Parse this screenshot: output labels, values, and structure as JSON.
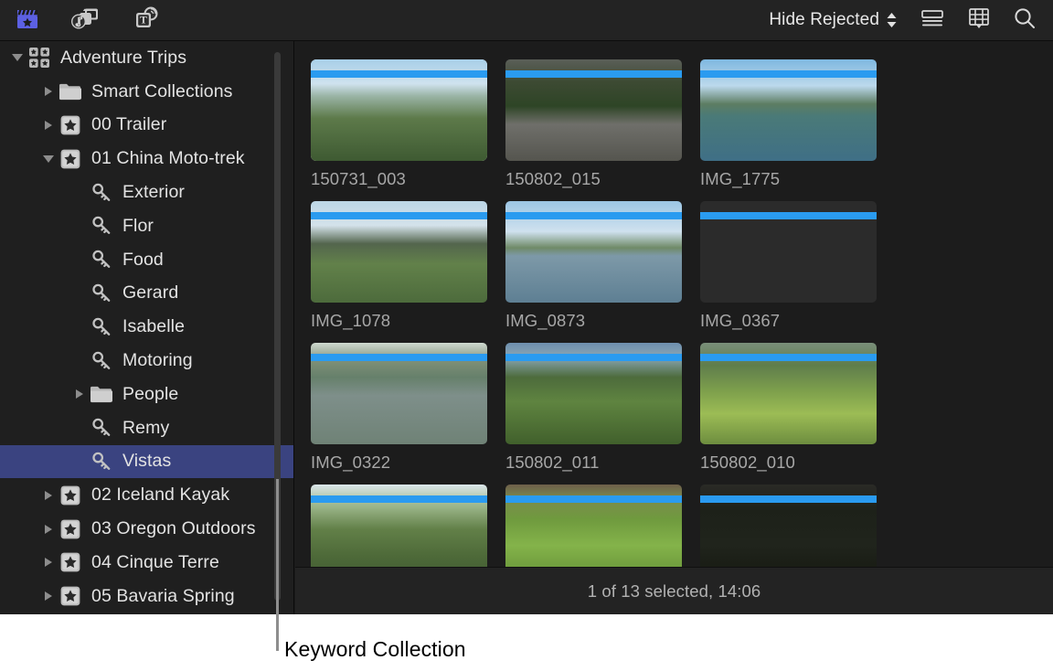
{
  "window": {
    "app": "Final Cut Pro",
    "background_color": "#1c1c1c"
  },
  "toolbar": {
    "icons_left": [
      {
        "name": "libraries-icon",
        "label": "Libraries",
        "color": "#5c60e2"
      },
      {
        "name": "photos-audio-icon",
        "label": "Photos and Audio"
      },
      {
        "name": "titles-generators-icon",
        "label": "Titles and Generators"
      }
    ],
    "filter_label": "Hide Rejected",
    "icons_right": [
      {
        "name": "list-view-icon",
        "label": "List View"
      },
      {
        "name": "filmstrip-view-icon",
        "label": "Filmstrip View"
      },
      {
        "name": "search-icon",
        "label": "Search"
      }
    ]
  },
  "sidebar": {
    "scrollbar_visible": true,
    "items": [
      {
        "label": "Adventure Trips",
        "icon": "library-icon",
        "indent": 0,
        "disclosure": "down",
        "selected": false
      },
      {
        "label": "Smart Collections",
        "icon": "folder-icon",
        "indent": 1,
        "disclosure": "right",
        "selected": false
      },
      {
        "label": "00 Trailer",
        "icon": "event-star-icon",
        "indent": 1,
        "disclosure": "right",
        "selected": false
      },
      {
        "label": "01 China Moto-trek",
        "icon": "event-star-icon",
        "indent": 1,
        "disclosure": "down",
        "selected": false
      },
      {
        "label": "Exterior",
        "icon": "keyword-key-icon",
        "indent": 2,
        "disclosure": "none",
        "selected": false
      },
      {
        "label": "Flor",
        "icon": "keyword-key-icon",
        "indent": 2,
        "disclosure": "none",
        "selected": false
      },
      {
        "label": "Food",
        "icon": "keyword-key-icon",
        "indent": 2,
        "disclosure": "none",
        "selected": false
      },
      {
        "label": "Gerard",
        "icon": "keyword-key-icon",
        "indent": 2,
        "disclosure": "none",
        "selected": false
      },
      {
        "label": "Isabelle",
        "icon": "keyword-key-icon",
        "indent": 2,
        "disclosure": "none",
        "selected": false
      },
      {
        "label": "Motoring",
        "icon": "keyword-key-icon",
        "indent": 2,
        "disclosure": "none",
        "selected": false
      },
      {
        "label": "People",
        "icon": "folder-icon",
        "indent": 2,
        "disclosure": "right",
        "selected": false
      },
      {
        "label": "Remy",
        "icon": "keyword-key-icon",
        "indent": 2,
        "disclosure": "none",
        "selected": false
      },
      {
        "label": "Vistas",
        "icon": "keyword-key-icon",
        "indent": 2,
        "disclosure": "none",
        "selected": true
      },
      {
        "label": "02 Iceland Kayak",
        "icon": "event-star-icon",
        "indent": 1,
        "disclosure": "right",
        "selected": false
      },
      {
        "label": "03 Oregon Outdoors",
        "icon": "event-star-icon",
        "indent": 1,
        "disclosure": "right",
        "selected": false
      },
      {
        "label": "04 Cinque Terre",
        "icon": "event-star-icon",
        "indent": 1,
        "disclosure": "right",
        "selected": false
      },
      {
        "label": "05 Bavaria Spring",
        "icon": "event-star-icon",
        "indent": 1,
        "disclosure": "right",
        "selected": false
      }
    ],
    "selection_color": "#3a4380"
  },
  "browser": {
    "keyword_bar_color": "#2a9bf0",
    "clips": [
      {
        "name": "150731_003",
        "selected": true,
        "art": "cliff-valley",
        "clipped": false
      },
      {
        "name": "150802_015",
        "selected": false,
        "art": "mountain-road",
        "clipped": false
      },
      {
        "name": "IMG_1775",
        "selected": false,
        "art": "karst-lake",
        "clipped": false
      },
      {
        "name": "IMG_1078",
        "selected": false,
        "art": "karst-fields",
        "clipped": false
      },
      {
        "name": "IMG_0873",
        "selected": false,
        "art": "river-mirror",
        "clipped": false
      },
      {
        "name": "IMG_0367",
        "selected": false,
        "art": "portrait-river",
        "clipped": false
      },
      {
        "name": "IMG_0322",
        "selected": false,
        "art": "raft-river",
        "clipped": false
      },
      {
        "name": "150802_011",
        "selected": false,
        "art": "green-terrace",
        "clipped": false
      },
      {
        "name": "150802_010",
        "selected": false,
        "art": "rice-hikers",
        "clipped": false
      },
      {
        "name": "",
        "selected": false,
        "art": "trail-hikers",
        "clipped": true
      },
      {
        "name": "",
        "selected": false,
        "art": "paddy-rows",
        "clipped": true
      },
      {
        "name": "",
        "selected": false,
        "art": "silhouettes",
        "clipped": true
      }
    ]
  },
  "statusbar": {
    "text": "1 of 13 selected, 14:06"
  },
  "callout": {
    "label": "Keyword Collection"
  }
}
